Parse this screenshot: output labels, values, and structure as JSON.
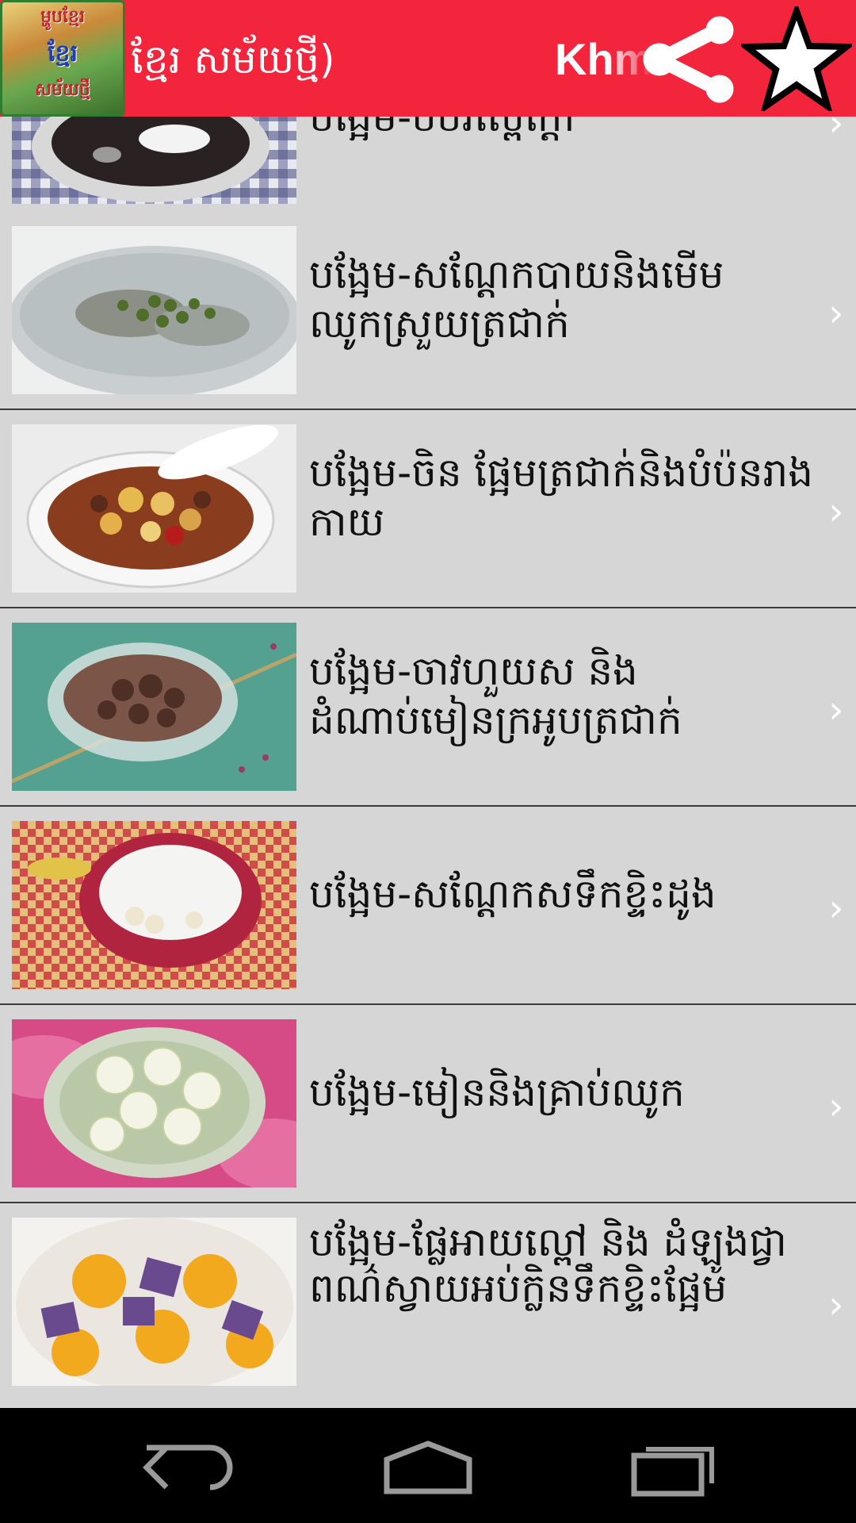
{
  "header": {
    "logo_icon": "app-logo-image",
    "logo_lines": [
      "ម្ហូបខ្មែរ",
      "ខ្មែរ",
      "សម័យថ្មី"
    ],
    "title_left": "ខ្មែរ សម័យថ្មី)",
    "title_right": "Khm",
    "share_icon": "share-icon",
    "favorite_icon": "star-icon",
    "accent_color": "#f2253d"
  },
  "list": {
    "items": [
      {
        "label": "បង្អែម-បបរស្ពៃក្ដៅ",
        "thumb": "black-sesame-dessert-bowl"
      },
      {
        "label": "បង្អែម-សណ្ដែកបាយនិងមើមឈូកស្រួយត្រជាក់",
        "thumb": "mung-bean-lotus-root-bowl"
      },
      {
        "label": "បង្អែម-ចិន ផ្អែមត្រជាក់និងបំប៉នរាងកាយ",
        "thumb": "chinese-sweet-soup-bowl"
      },
      {
        "label": "បង្អែម-ចាវហួយស និង ដំណាប់មៀនក្រអូបត្រជាក់",
        "thumb": "longan-jelly-glass-bowl"
      },
      {
        "label": "បង្អែម-សណ្ដែកសទឹកខ្ទិះដូង",
        "thumb": "white-bean-coconut-bowl"
      },
      {
        "label": "បង្អែម-មៀននិងគ្រាប់ឈូក",
        "thumb": "longan-lotus-seed-bowl"
      },
      {
        "label": "បង្អែម-ផ្លែអាយល្ពៅ និង ដំឡូងជ្វាពណ៌ស្វាយអប់ក្លិនទឹកខ្ទិះផ្អែម",
        "thumb": "pumpkin-purple-yam-bowl"
      }
    ],
    "chevron": "›"
  },
  "navbar": {
    "back_icon": "back-icon",
    "home_icon": "home-icon",
    "recents_icon": "recents-icon"
  }
}
